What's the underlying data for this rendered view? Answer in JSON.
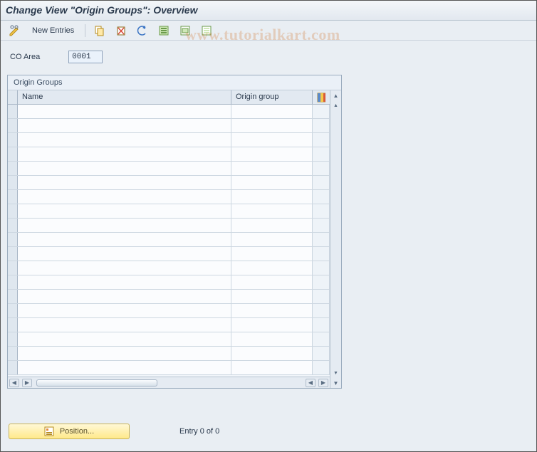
{
  "title": "Change View \"Origin Groups\": Overview",
  "watermark": "www.tutorialkart.com",
  "toolbar": {
    "new_entries_label": "New Entries"
  },
  "form": {
    "co_area_label": "CO Area",
    "co_area_value": "0001"
  },
  "grid": {
    "title": "Origin Groups",
    "columns": {
      "name": "Name",
      "origin_group": "Origin group"
    },
    "row_count": 19
  },
  "footer": {
    "position_label": "Position...",
    "entry_status": "Entry 0 of 0"
  }
}
